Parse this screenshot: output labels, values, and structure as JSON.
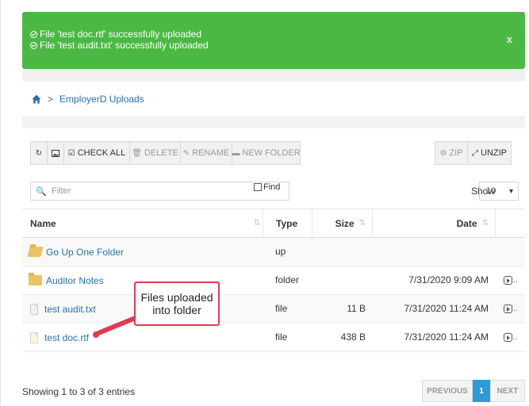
{
  "alert": {
    "messages": [
      "File 'test doc.rtf' successfully uploaded",
      "File 'test audit.txt' successfully uploaded"
    ],
    "close_label": "x"
  },
  "breadcrumb": {
    "separator": ">",
    "current": "EmployerD Uploads"
  },
  "toolbar": {
    "check_all": "CHECK ALL",
    "delete": "DELETE",
    "rename": "RENAME",
    "new_folder": "NEW FOLDER",
    "zip": "ZIP",
    "unzip": "UNZIP"
  },
  "filter": {
    "placeholder": "Filter",
    "find_label": "Find",
    "show_label": "Show",
    "show_value": "10"
  },
  "table": {
    "headers": {
      "name": "Name",
      "type": "Type",
      "size": "Size",
      "date": "Date"
    },
    "rows": [
      {
        "name": "Go Up One Folder",
        "type": "up",
        "size": "",
        "date": ""
      },
      {
        "name": "Auditor Notes",
        "type": "folder",
        "size": "",
        "date": "7/31/2020 9:09 AM"
      },
      {
        "name": "test audit.txt",
        "type": "file",
        "size": "11 B",
        "date": "7/31/2020 11:24 AM"
      },
      {
        "name": "test doc.rtf",
        "type": "file",
        "size": "438 B",
        "date": "7/31/2020 11:24 AM"
      }
    ]
  },
  "footer": {
    "info": "Showing 1 to 3 of 3 entries",
    "previous": "PREVIOUS",
    "page": "1",
    "next": "NEXT"
  },
  "callout": {
    "text": "Files uploaded into folder"
  },
  "colors": {
    "success": "#4cb844",
    "link": "#2a6fb0",
    "annotation": "#e23a4e",
    "pager_active": "#2e9bd8"
  }
}
